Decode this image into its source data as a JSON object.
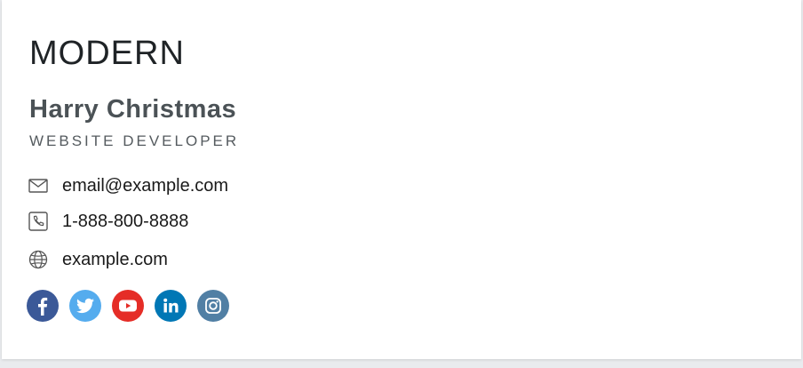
{
  "signature": {
    "style_title": "MODERN",
    "name": "Harry Christmas",
    "role": "WEBSITE DEVELOPER",
    "contacts": [
      {
        "icon": "envelope-icon",
        "text": "email@example.com"
      },
      {
        "icon": "phone-icon",
        "text": "1-888-800-8888"
      },
      {
        "icon": "globe-icon",
        "text": "example.com"
      }
    ],
    "socials": [
      {
        "icon": "facebook-icon",
        "color": "#3b5998"
      },
      {
        "icon": "twitter-icon",
        "color": "#55acee"
      },
      {
        "icon": "youtube-icon",
        "color": "#e52d27"
      },
      {
        "icon": "linkedin-icon",
        "color": "#0077b5"
      },
      {
        "icon": "instagram-icon",
        "color": "#517fa4"
      }
    ]
  }
}
